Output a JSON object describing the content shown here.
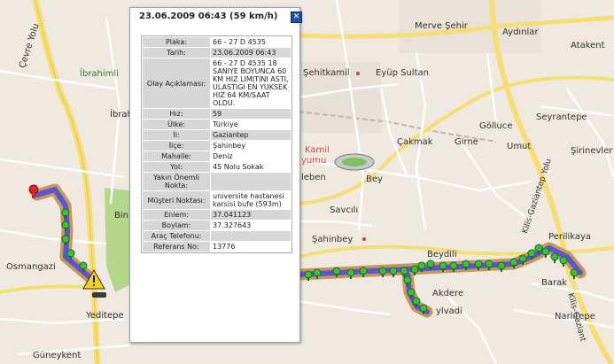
{
  "popup": {
    "title": "23.06.2009 06:43 (59 km/h)",
    "close_label": "✕",
    "rows": [
      {
        "label": "Plaka:",
        "value": "66 - 27 D 4535"
      },
      {
        "label": "Tarih:",
        "value": "23.06.2009 06:43"
      },
      {
        "label": "Olay Açıklaması:",
        "value": "66 - 27 D 4535 18 SANIYE BOYUNCA 60 KM HIZ LIMITINI ASTI, ULASTIGI EN YUKSEK HIZ 64 KM/SAAT OLDU."
      },
      {
        "label": "Hız:",
        "value": "59"
      },
      {
        "label": "Ülke:",
        "value": "Türkiye"
      },
      {
        "label": "İl:",
        "value": "Gaziantep"
      },
      {
        "label": "İlçe:",
        "value": "Şahinbey"
      },
      {
        "label": "Mahalle:",
        "value": "Deniz"
      },
      {
        "label": "Yol:",
        "value": "45 Nolu Sokak"
      },
      {
        "label": "Yakın Önemli Nokta:",
        "value": ""
      },
      {
        "label": "Müşteri Noktası:",
        "value": "universite hastanesi karsisi bufe (593m)"
      },
      {
        "label": "Enlem:",
        "value": "37.041123"
      },
      {
        "label": "Boylam:",
        "value": "37.327643"
      },
      {
        "label": "Araç Telefonu:",
        "value": ""
      },
      {
        "label": "Referans No:",
        "value": "13776"
      }
    ]
  },
  "map": {
    "labels": {
      "cevre_yolu": "Çevre Yolu",
      "ibrahimli": "İbrahimli",
      "ibra": "İbrah",
      "bin": "Bin",
      "osmangazi": "Osmangazi",
      "yeditepe": "Yeditepe",
      "guneykent": "Güneykent",
      "merve_sehir": "Merve Şehir",
      "aydinlar": "Aydınlar",
      "atakent": "Atakent",
      "sehitkamil": "Şehitkamil",
      "eyup_sultan": "Eyüp Sultan",
      "seyrantepe": "Seyrantepe",
      "kamil": "Kamil",
      "yumu": "yumu",
      "cakmak": "Çakmak",
      "girne": "Girne",
      "golluce": "Gölluce",
      "umut": "Umut",
      "sirinevler": "Şirinevler",
      "leben": "leben",
      "bey": "Bey",
      "savcili": "Savcılı",
      "sahinbey": "Şahinbey",
      "beydili": "Beydili",
      "akdere": "Akdere",
      "ylvadi": "ylvadi",
      "barak": "Barak",
      "narlitepe": "Narlıtepe",
      "perilikaya": "Perilikaya",
      "kilis_gaziantep_yolu": "Kilis-Gaziantep Yolu",
      "kilis_gaziant": "Kilis-Gaziant"
    },
    "colors": {
      "background": "#efe9df",
      "road_white": "#ffffff",
      "road_yellow": "#f5de73",
      "route": "#5a55d6",
      "halo": "#b88a45",
      "pin_green": "#36c23b",
      "warning": "#f4d21c"
    }
  }
}
